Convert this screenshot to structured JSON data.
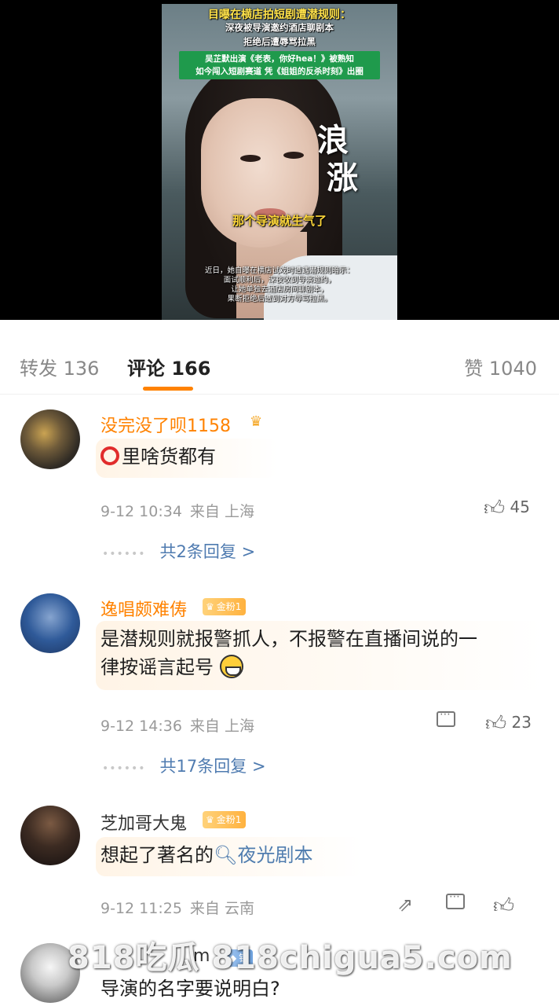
{
  "video": {
    "title1": "目曝在横店拍短剧遭潜规则：",
    "title2": "深夜被导演邀约酒店聊剧本",
    "title3": "拒绝后遭辱骂拉黑",
    "green_line1": "吴芷默出演《老表，你好hea！》被熟知",
    "green_line2": "如今闯入短剧赛道 凭《姐姐的反杀时刻》出圈",
    "logo_line1": "浪",
    "logo_line2": "涨",
    "subtitle": "那个导演就生气了",
    "desc1": "近日，她自曝在横店试戏时遭遇潜规则暗示：",
    "desc2": "面试顺利后，深夜收到导演邀约，",
    "desc3": "让她单独去酒店房间聊剧本，",
    "desc4": "果断拒绝后遭到对方辱骂拉黑。"
  },
  "tabs": {
    "forward": "转发 136",
    "comment": "评论 166",
    "like": "赞 1040"
  },
  "comments": [
    {
      "username": "没完没了呗1158",
      "text": "里啥货都有",
      "date": "9-12 10:34",
      "source": "来自 上海",
      "likes": "45",
      "replies": "共2条回复 >"
    },
    {
      "username": "逸唱颇难俦",
      "badge": "金粉1",
      "text_line1": "是潜规则就报警抓人，不报警在直播间说的一",
      "text_line2": "律按谣言起号",
      "date": "9-12 14:36",
      "source": "来自 上海",
      "likes": "23",
      "replies": "共17条回复 >"
    },
    {
      "username": "芝加哥大鬼",
      "badge": "金粉1",
      "text_prefix": "想起了著名的",
      "search_text": "夜光剧本",
      "date": "9-12 11:25",
      "source": "来自 云南"
    },
    {
      "username_visible": "m",
      "badge": "铁",
      "text": "导演的名字要说明白?"
    }
  ],
  "watermark": "818吃瓜 818chigua5.com",
  "icons": {
    "like": "thumb-up-icon",
    "reply": "reply-icon",
    "share": "share-icon"
  },
  "colors": {
    "accent": "#ff8200",
    "link": "#4f7bb0"
  }
}
